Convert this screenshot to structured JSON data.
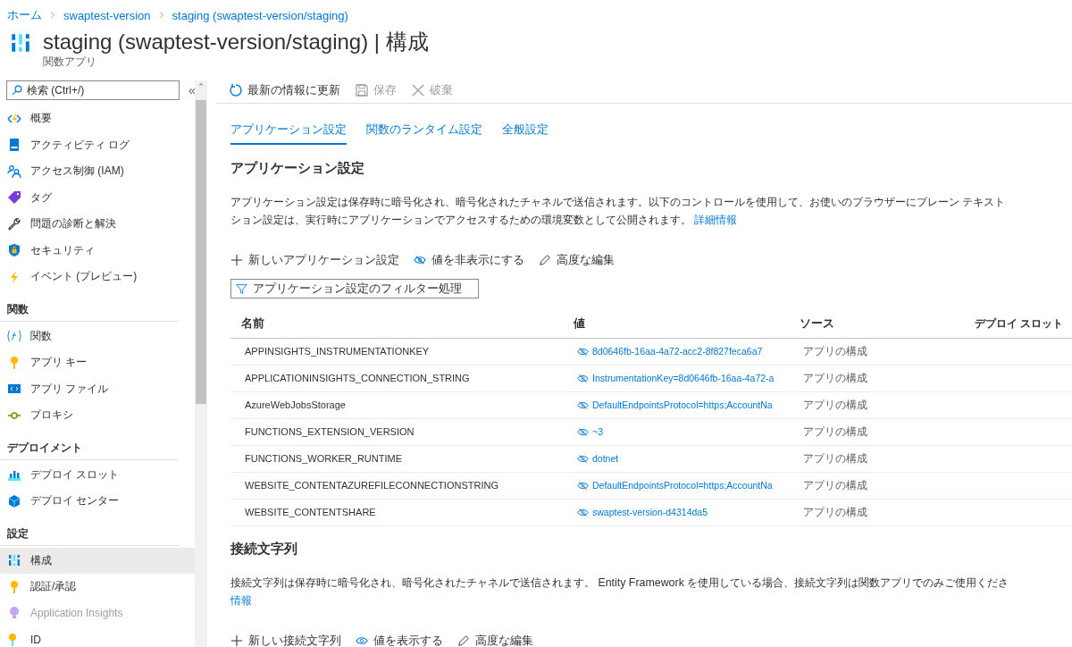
{
  "breadcrumb": [
    "ホーム",
    "swaptest-version",
    "staging (swaptest-version/staging)"
  ],
  "page": {
    "title": "staging (swaptest-version/staging) | 構成",
    "subtitle": "関数アプリ"
  },
  "sidebar": {
    "search": {
      "placeholder": "検索 (Ctrl+/)"
    },
    "collapse": "«",
    "items": [
      {
        "kind": "item",
        "label": "概要",
        "selected": false,
        "disabled": false
      },
      {
        "kind": "item",
        "label": "アクティビティ ログ",
        "selected": false,
        "disabled": false
      },
      {
        "kind": "item",
        "label": "アクセス制御 (IAM)",
        "selected": false,
        "disabled": false
      },
      {
        "kind": "item",
        "label": "タグ",
        "selected": false,
        "disabled": false
      },
      {
        "kind": "item",
        "label": "問題の診断と解決",
        "selected": false,
        "disabled": false
      },
      {
        "kind": "item",
        "label": "セキュリティ",
        "selected": false,
        "disabled": false
      },
      {
        "kind": "item",
        "label": "イベント (プレビュー)",
        "selected": false,
        "disabled": false
      },
      {
        "kind": "section",
        "label": "関数"
      },
      {
        "kind": "item",
        "label": "関数",
        "selected": false,
        "disabled": false
      },
      {
        "kind": "item",
        "label": "アプリ キー",
        "selected": false,
        "disabled": false
      },
      {
        "kind": "item",
        "label": "アプリ ファイル",
        "selected": false,
        "disabled": false
      },
      {
        "kind": "item",
        "label": "プロキシ",
        "selected": false,
        "disabled": false
      },
      {
        "kind": "section",
        "label": "デプロイメント"
      },
      {
        "kind": "item",
        "label": "デプロイ スロット",
        "selected": false,
        "disabled": false
      },
      {
        "kind": "item",
        "label": "デプロイ センター",
        "selected": false,
        "disabled": false
      },
      {
        "kind": "section",
        "label": "設定"
      },
      {
        "kind": "item",
        "label": "構成",
        "selected": true,
        "disabled": false
      },
      {
        "kind": "item",
        "label": "認証/承認",
        "selected": false,
        "disabled": false
      },
      {
        "kind": "item",
        "label": "Application Insights",
        "selected": false,
        "disabled": true
      },
      {
        "kind": "item",
        "label": "ID",
        "selected": false,
        "disabled": false
      }
    ]
  },
  "toolbar": [
    {
      "kind": "refresh",
      "label": "最新の情報に更新",
      "disabled": false
    },
    {
      "kind": "save",
      "label": "保存",
      "disabled": true
    },
    {
      "kind": "discard",
      "label": "破棄",
      "disabled": true
    }
  ],
  "tabs": [
    {
      "label": "アプリケーション設定",
      "selected": true
    },
    {
      "label": "関数のランタイム設定",
      "selected": false
    },
    {
      "label": "全般設定",
      "selected": false
    }
  ],
  "app_settings": {
    "heading": "アプリケーション設定",
    "description_lines": [
      "アプリケーション設定は保存時に暗号化され、暗号化されたチャネルで送信されます。以下のコントロールを使用して、お使いのブラウザーにプレーン テキスト",
      "ション設定は、実行時にアプリケーションでアクセスするための環境変数として公開されます。"
    ],
    "link": "詳細情報",
    "actions": [
      {
        "kind": "add",
        "label": "新しいアプリケーション設定"
      },
      {
        "kind": "hide",
        "label": "値を非表示にする"
      },
      {
        "kind": "edit",
        "label": "高度な編集"
      }
    ],
    "filter": {
      "placeholder": "アプリケーション設定のフィルター処理"
    },
    "table": {
      "columns": [
        "名前",
        "値",
        "ソース",
        "デプロイ スロット"
      ],
      "rows": [
        [
          "APPINSIGHTS_INSTRUMENTATIONKEY",
          "8d0646fb-16aa-4a72-acc2-8f827feca6a7",
          "アプリの構成"
        ],
        [
          "APPLICATIONINSIGHTS_CONNECTION_STRING",
          "InstrumentationKey=8d0646fb-16aa-4a72-a",
          "アプリの構成"
        ],
        [
          "AzureWebJobsStorage",
          "DefaultEndpointsProtocol=https;AccountNa",
          "アプリの構成"
        ],
        [
          "FUNCTIONS_EXTENSION_VERSION",
          "~3",
          "アプリの構成"
        ],
        [
          "FUNCTIONS_WORKER_RUNTIME",
          "dotnet",
          "アプリの構成"
        ],
        [
          "WEBSITE_CONTENTAZUREFILECONNECTIONSTRING",
          "DefaultEndpointsProtocol=https;AccountNa",
          "アプリの構成"
        ],
        [
          "WEBSITE_CONTENTSHARE",
          "swaptest-version-d4314da5",
          "アプリの構成"
        ]
      ]
    }
  },
  "connection_strings": {
    "heading": "接続文字列",
    "description_lines": [
      "接続文字列は保存時に暗号化され、暗号化されたチャネルで送信されます。 Entity Framework を使用している場合、接続文字列は関数アプリでのみご使用くださ"
    ],
    "link": "情報",
    "actions": [
      {
        "kind": "add",
        "label": "新しい接続文字列"
      },
      {
        "kind": "show",
        "label": "値を表示する"
      },
      {
        "kind": "edit",
        "label": "高度な編集"
      }
    ]
  }
}
